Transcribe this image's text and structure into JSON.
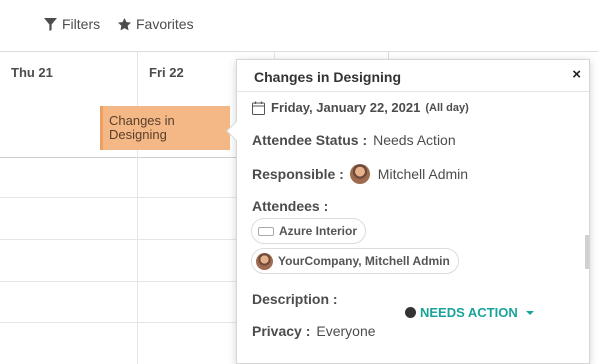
{
  "toolbar": {
    "filters_label": "Filters",
    "favorites_label": "Favorites"
  },
  "calendar": {
    "days": [
      "Thu 21",
      "Fri 22"
    ],
    "event": {
      "title": "Changes in Designing",
      "color": "#f4b886"
    }
  },
  "popover": {
    "title": "Changes in Designing",
    "close_glyph": "×",
    "date_main": "Friday, January 22, 2021",
    "date_sub": "(All day)",
    "attendee_status_label": "Attendee Status :",
    "attendee_status_value": "Needs Action",
    "responsible_label": "Responsible :",
    "responsible_value": "Mitchell Admin",
    "attendees_label": "Attendees :",
    "attendees": [
      "Azure Interior",
      "YourCompany, Mitchell Admin"
    ],
    "description_label": "Description :",
    "privacy_label": "Privacy :",
    "privacy_value": "Everyone",
    "status_button": "NEEDS ACTION",
    "accent_color": "#1aa39a"
  }
}
